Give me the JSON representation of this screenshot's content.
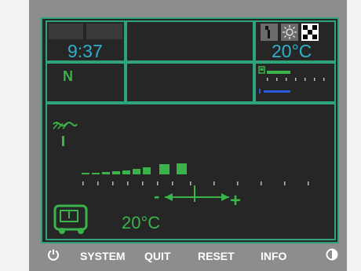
{
  "status": {
    "clock": "9:37",
    "temperature_top": "20°C",
    "gear": "N"
  },
  "main_panel": {
    "temperature": "20°C",
    "slider_minus": "-",
    "slider_plus": "+"
  },
  "nav": {
    "power_icon": "power-icon",
    "system_label": "SYSTEM",
    "quit_label": "QUIT",
    "reset_label": "RESET",
    "info_label": "INFO",
    "contrast_icon": "contrast-icon"
  },
  "colors": {
    "accent_green": "#3ab34a",
    "border_teal": "#2fa37a",
    "text_cyan": "#2fb0c8",
    "blue_bar": "#2b5bd6"
  }
}
